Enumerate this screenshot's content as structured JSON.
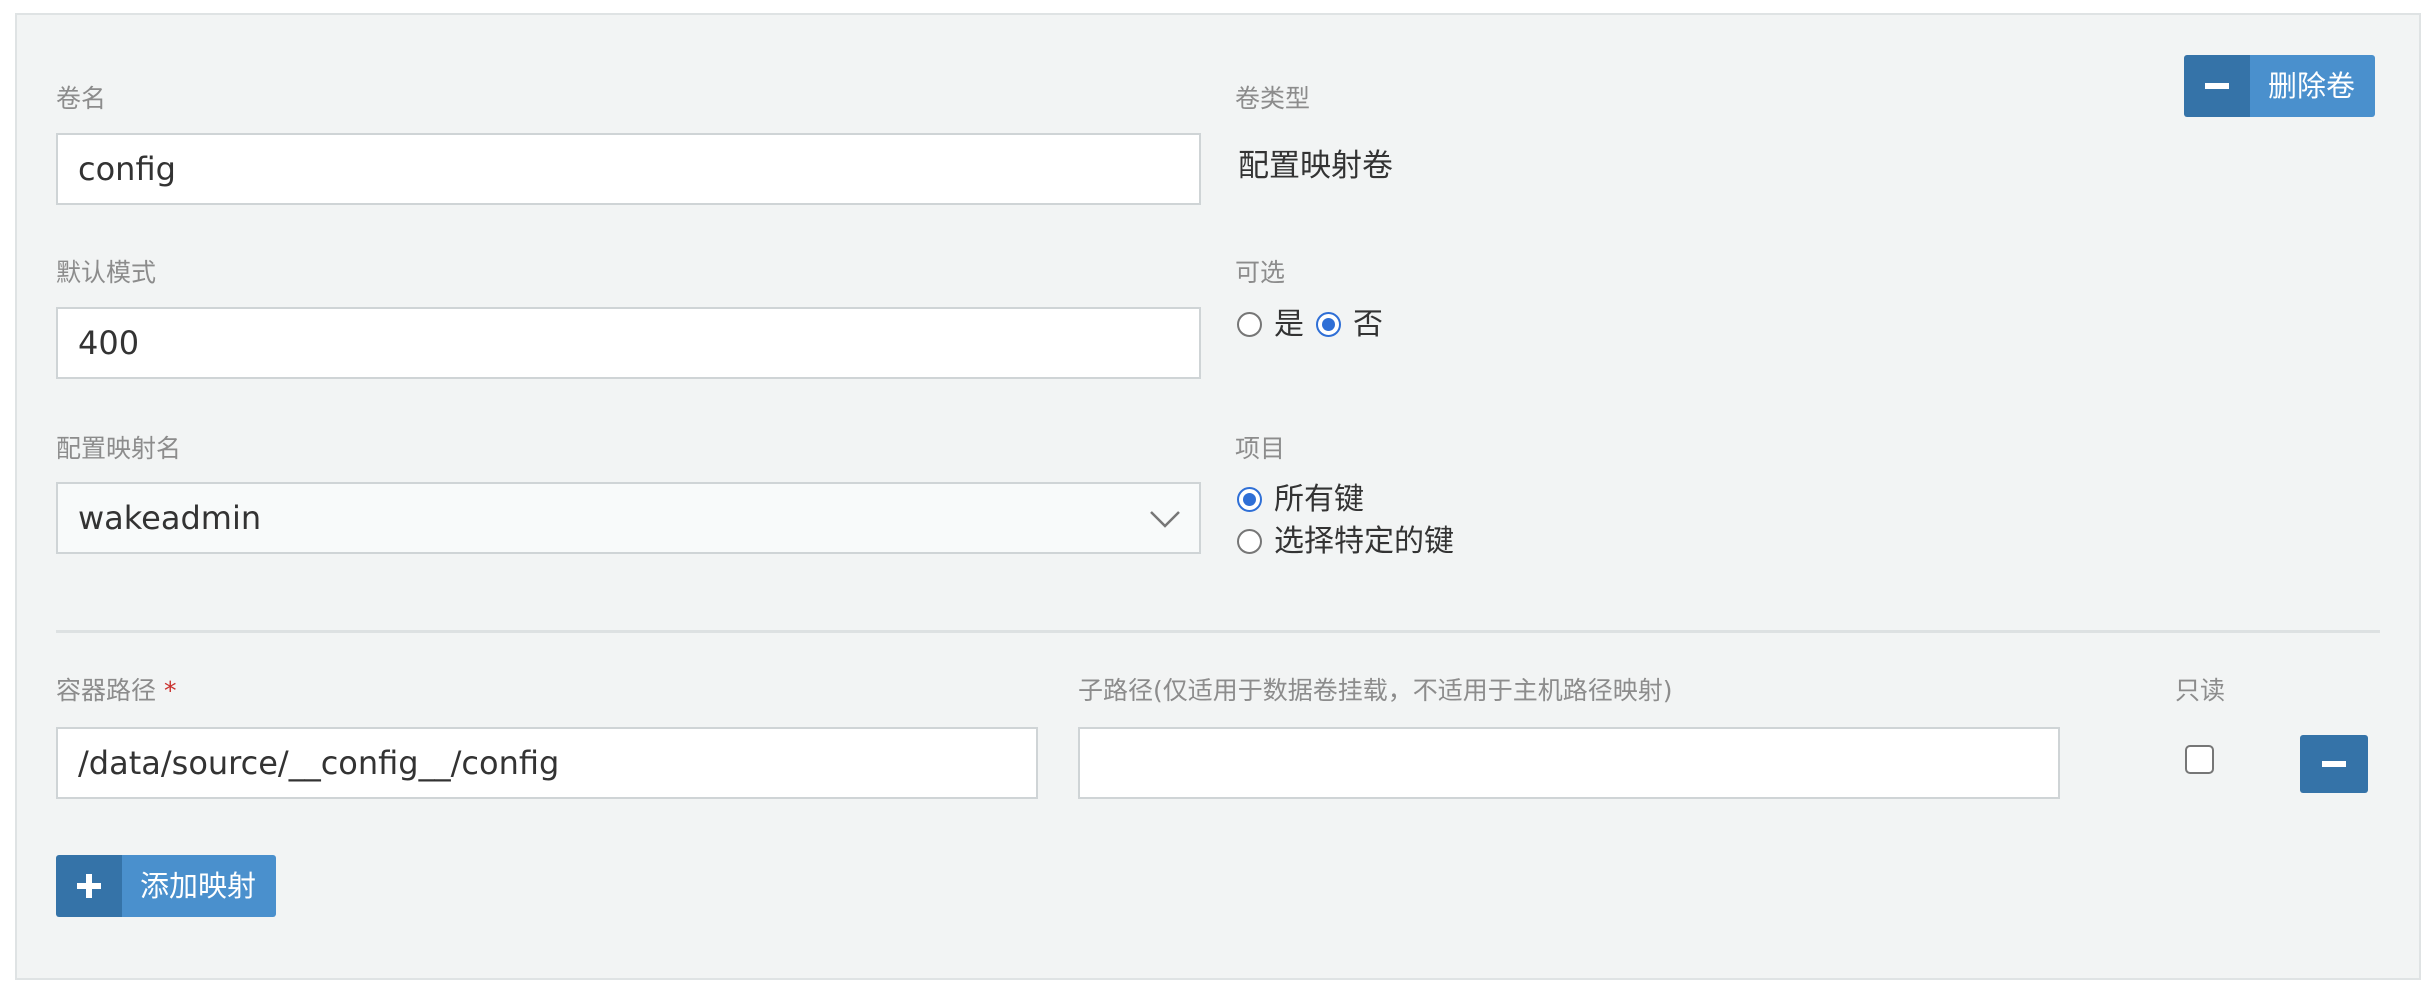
{
  "volume_name": {
    "label": "卷名",
    "value": "config"
  },
  "volume_type": {
    "label": "卷类型",
    "value": "配置映射卷"
  },
  "remove_volume_button": {
    "label": "删除卷"
  },
  "default_mode": {
    "label": "默认模式",
    "value": "400"
  },
  "optional": {
    "label": "可选",
    "options": [
      {
        "label": "是",
        "selected": false
      },
      {
        "label": "否",
        "selected": true
      }
    ]
  },
  "configmap_name": {
    "label": "配置映射名",
    "value": "wakeadmin"
  },
  "items": {
    "label": "项目",
    "options": [
      {
        "label": "所有键",
        "selected": true
      },
      {
        "label": "选择特定的键",
        "selected": false
      }
    ]
  },
  "mount": {
    "container_path_label": "容器路径",
    "required_mark": "*",
    "container_path_value": "/data/source/__config__/config",
    "subpath_label": "子路径(仅适用于数据卷挂载，不适用于主机路径映射)",
    "subpath_value": "",
    "readonly_label": "只读",
    "readonly_checked": false
  },
  "add_mapping_button": {
    "label": "添加映射"
  },
  "colors": {
    "button_icon_bg": "#3573a8",
    "button_text_bg": "#4a90cd",
    "radio_accent": "#2f6fd6"
  }
}
